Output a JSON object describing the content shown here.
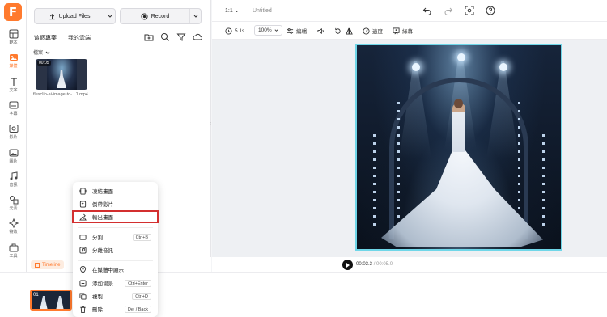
{
  "rail": {
    "items": [
      {
        "label": "範本",
        "icon": "template-icon"
      },
      {
        "label": "媒體",
        "icon": "media-icon"
      },
      {
        "label": "文字",
        "icon": "text-icon"
      },
      {
        "label": "字幕",
        "icon": "subtitle-icon"
      },
      {
        "label": "影片",
        "icon": "video-icon"
      },
      {
        "label": "圖片",
        "icon": "image-icon"
      },
      {
        "label": "音訊",
        "icon": "audio-icon"
      },
      {
        "label": "元素",
        "icon": "elements-icon"
      },
      {
        "label": "特效",
        "icon": "effects-icon"
      },
      {
        "label": "工具",
        "icon": "tools-icon"
      }
    ],
    "active_index": 1
  },
  "panel": {
    "upload_label": "Upload Files",
    "record_label": "Record",
    "tabs": [
      "這個專案",
      "我的雲端"
    ],
    "filter_label": "檔案",
    "thumb_duration": "00:05",
    "thumb_name": "flexclip-ai-image-to-...1.mp4"
  },
  "topbar": {
    "ratio": "1:1",
    "title": "Untitled"
  },
  "toolbar": {
    "duration": "5.1s",
    "zoom": "100%",
    "edit": "編輯",
    "speed": "速度",
    "crop": "綠幕"
  },
  "playback": {
    "current": "00:03.3",
    "total": "/ 00:05.0"
  },
  "timeline": {
    "tab_label": "Timeline",
    "clip_number": "01"
  },
  "context_menu": {
    "items": [
      {
        "label": "凍結畫面",
        "shortcut": "",
        "icon": "freeze-frame-icon"
      },
      {
        "label": "倒帶影片",
        "shortcut": "",
        "icon": "reverse-video-icon"
      },
      {
        "label": "輸出畫面",
        "shortcut": "",
        "icon": "export-frame-icon",
        "highlighted": true
      },
      {
        "label": "分割",
        "shortcut": "Ctrl+B",
        "icon": "split-icon"
      },
      {
        "label": "分離音訊",
        "shortcut": "",
        "icon": "detach-audio-icon"
      },
      {
        "label": "在媒體中顯示",
        "shortcut": "",
        "icon": "locate-icon"
      },
      {
        "label": "添加場景",
        "shortcut": "Ctrl+Enter",
        "icon": "add-scene-icon"
      },
      {
        "label": "複製",
        "shortcut": "Ctrl+D",
        "icon": "duplicate-icon"
      },
      {
        "label": "刪除",
        "shortcut": "Del / Back",
        "icon": "trash-icon"
      }
    ]
  },
  "colors": {
    "accent": "#ff7a2e",
    "highlight_border": "#d32f2f",
    "preview_border": "#6fd6e8"
  }
}
